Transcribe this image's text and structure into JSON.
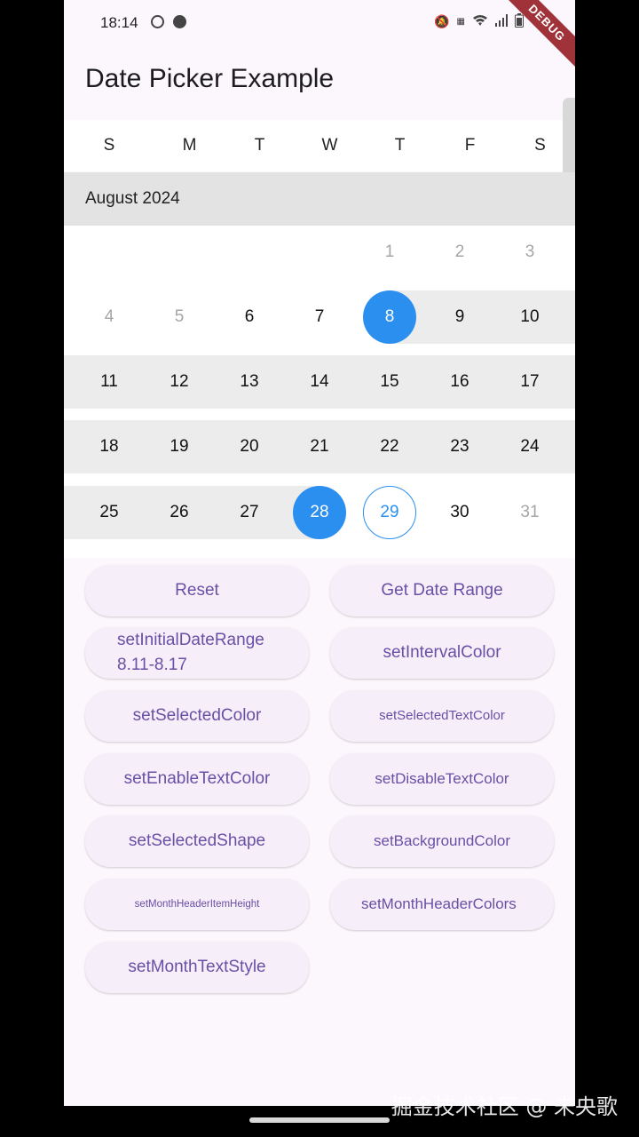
{
  "status_bar": {
    "time": "18:14",
    "icons": [
      "alarm-icon",
      "facebook-icon",
      "mute-icon",
      "volte-icon",
      "wifi-icon",
      "signal-icon",
      "battery-icon"
    ],
    "vowifi_label": "VoWiFi"
  },
  "debug_banner": "DEBUG",
  "app_bar": {
    "title": "Date Picker Example"
  },
  "weekdays": [
    "S",
    "M",
    "T",
    "W",
    "T",
    "F",
    "S"
  ],
  "month": {
    "label": "August 2024"
  },
  "calendar": {
    "rows": [
      [
        "",
        "",
        "",
        "",
        "1",
        "2",
        "3"
      ],
      [
        "4",
        "5",
        "6",
        "7",
        "8",
        "9",
        "10"
      ],
      [
        "11",
        "12",
        "13",
        "14",
        "15",
        "16",
        "17"
      ],
      [
        "18",
        "19",
        "20",
        "21",
        "22",
        "23",
        "24"
      ],
      [
        "25",
        "26",
        "27",
        "28",
        "29",
        "30",
        "31"
      ]
    ],
    "range_start": "8",
    "range_end": "28",
    "today": "29"
  },
  "buttons": {
    "reset": "Reset",
    "get_date_range": "Get Date Range",
    "set_initial_date_range": "setInitialDateRange 8.11-8.17",
    "set_interval_color": "setIntervalColor",
    "set_selected_color": "setSelectedColor",
    "set_selected_text_color": "setSelectedTextColor",
    "set_enable_text_color": "setEnableTextColor",
    "set_disable_text_color": "setDisableTextColor",
    "set_selected_shape": "setSelectedShape",
    "set_background_color": "setBackgroundColor",
    "set_month_header_item_height": "setMonthHeaderItemHeight",
    "set_month_header_colors": "setMonthHeaderColors",
    "set_month_text_style": "setMonthTextStyle"
  },
  "watermark": "掘金技术社区 @ 未央歌",
  "colors": {
    "selected": "#2b8ff0",
    "interval": "#ececec",
    "disabled_text": "#a6a6a6",
    "button_text": "#6a4fa6",
    "month_header": "#e3e3e3"
  }
}
